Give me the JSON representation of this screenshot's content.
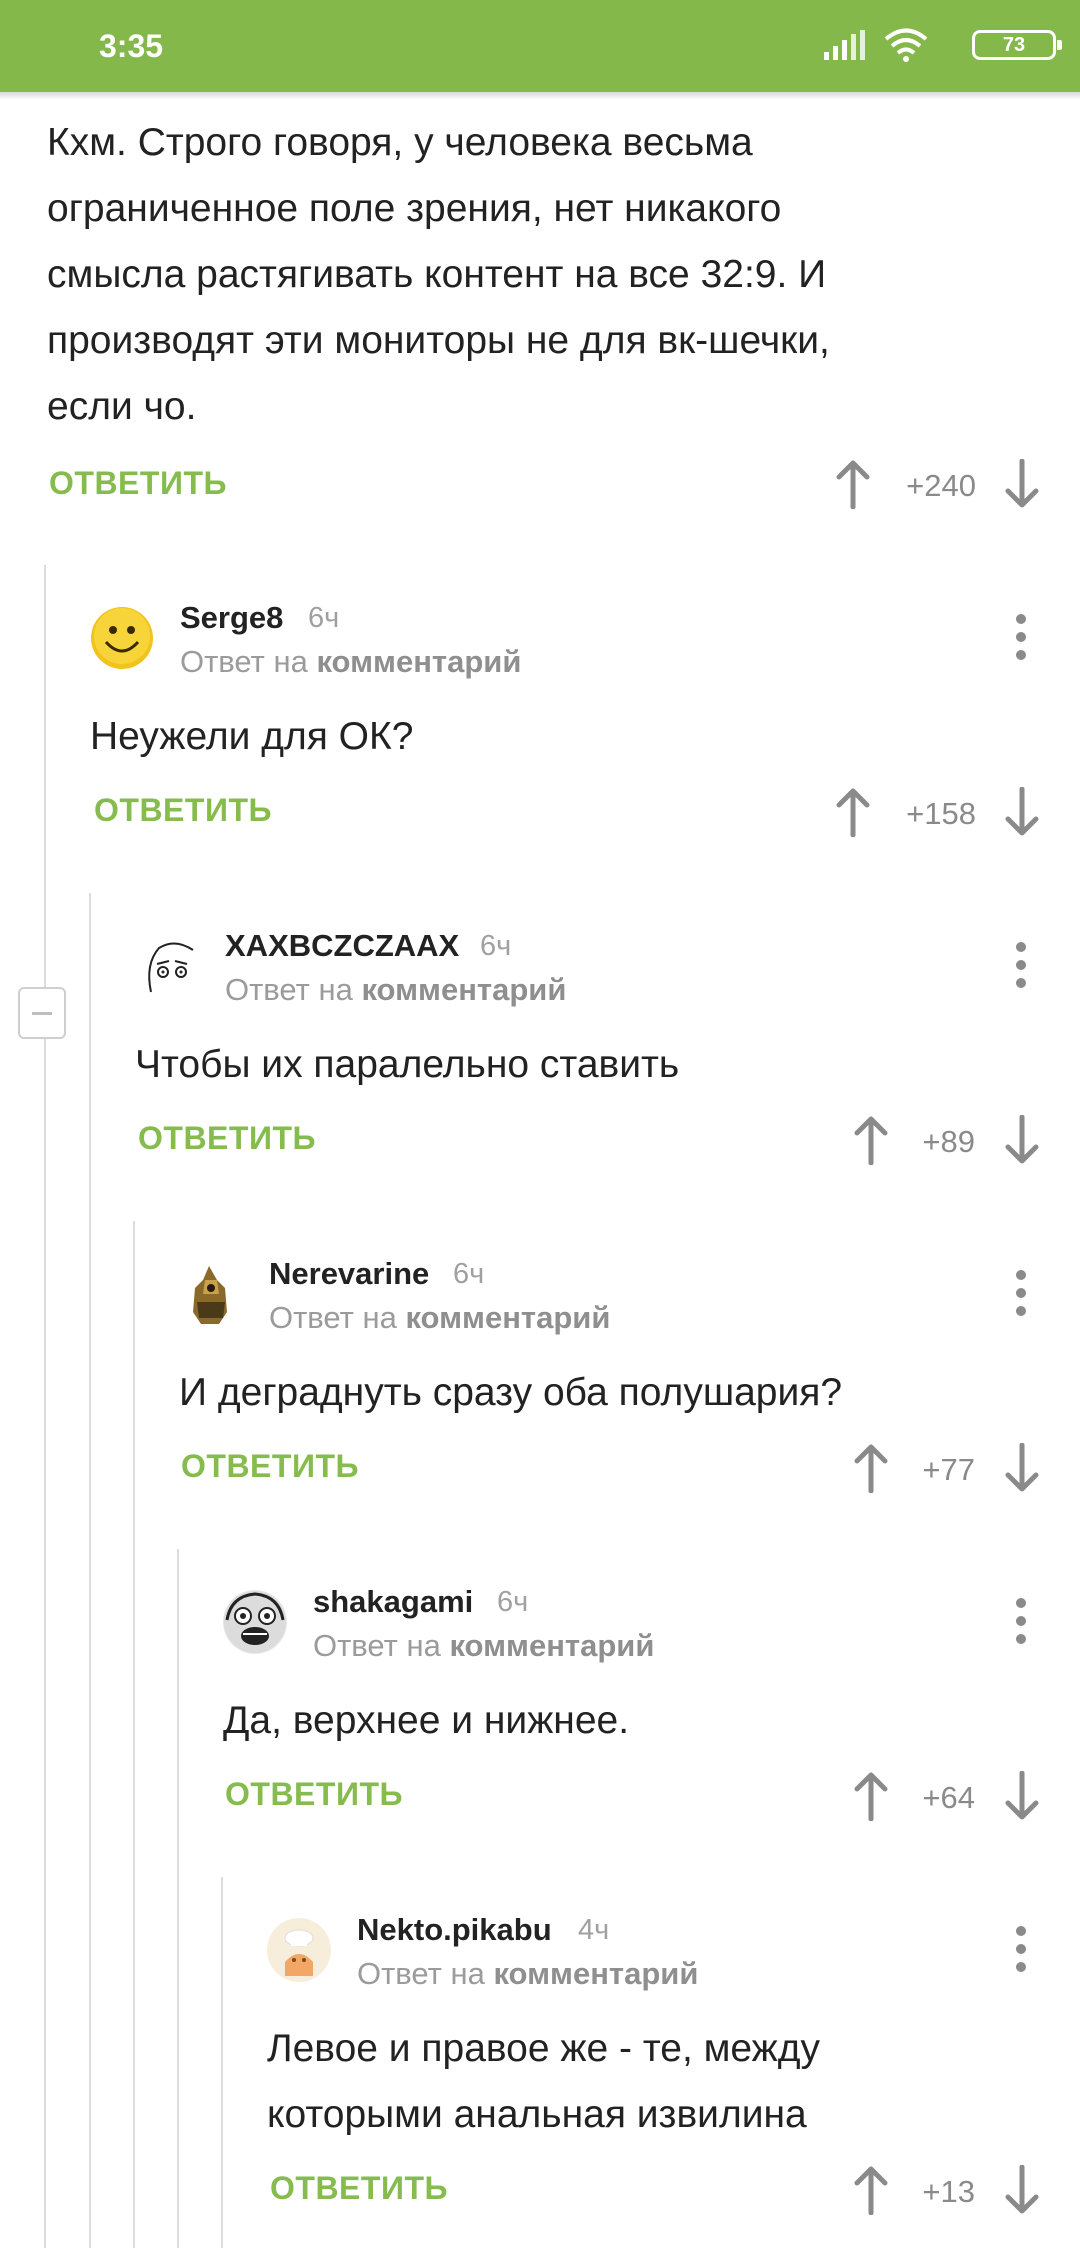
{
  "status_bar": {
    "time": "3:35",
    "battery": "73"
  },
  "root_comment": {
    "text_lines": [
      "Кхм. Строго говоря, у человека весьма",
      "ограниченное поле зрения, нет никакого",
      "смысла растягивать контент на все 32:9. И",
      "производят эти мониторы не для вк-шечки,",
      "если чо."
    ],
    "reply_label": "ОТВЕТИТЬ",
    "rating": "+240"
  },
  "reply_prefix": "Ответ на",
  "reply_target": "комментарий",
  "comments": [
    {
      "user": "Serge8",
      "time": "6ч",
      "text_lines": [
        "Неужели для ОК?"
      ],
      "reply_label": "ОТВЕТИТЬ",
      "rating": "+158",
      "avatar": "smiley-avatar"
    },
    {
      "user": "XAXBCZCZAAX",
      "time": "6ч",
      "text_lines": [
        "Чтобы их паралельно ставить"
      ],
      "reply_label": "ОТВЕТИТЬ",
      "rating": "+89",
      "avatar": "sketch-face-avatar"
    },
    {
      "user": "Nerevarine",
      "time": "6ч",
      "text_lines": [
        "И деградн­уть сразу оба полушария?"
      ],
      "reply_label": "ОТВЕТИТЬ",
      "rating": "+77",
      "avatar": "armored-figure-avatar"
    },
    {
      "user": "shakagami",
      "time": "6ч",
      "text_lines": [
        "Да, верхнее и нижнее."
      ],
      "reply_label": "ОТВЕТИТЬ",
      "rating": "+64",
      "avatar": "meme-face-avatar"
    },
    {
      "user": "Nekto.pikabu",
      "time": "4ч",
      "text_lines": [
        "Левое и правое же - те, между",
        "которыми анальная извилина"
      ],
      "reply_label": "ОТВЕТИТЬ",
      "rating": "+13",
      "avatar": "chef-avatar"
    }
  ],
  "colors": {
    "accent": "#86bb4d",
    "status_bar": "#85b84a",
    "muted": "#8a8a8a"
  }
}
